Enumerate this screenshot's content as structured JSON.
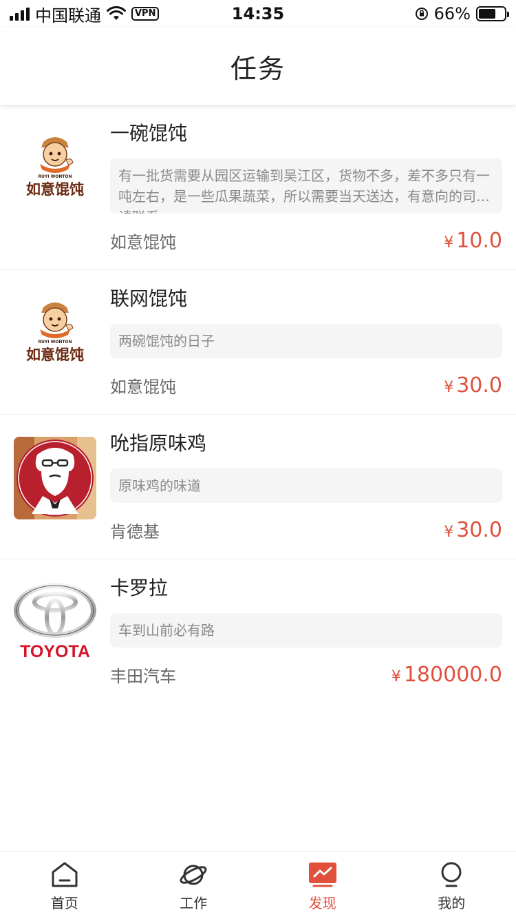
{
  "status_bar": {
    "carrier": "中国联通",
    "vpn": "VPN",
    "time": "14:35",
    "battery": "66%",
    "battery_fraction": 0.66
  },
  "header": {
    "title": "任务"
  },
  "tasks": [
    {
      "title": "一碗馄饨",
      "description": "有一批货需要从园区运输到吴江区，货物不多，差不多只有一吨左右，是一些瓜果蔬菜，所以需要当天送达，有意向的司机请联系。",
      "company": "如意馄饨",
      "currency": "¥",
      "price": "10.0",
      "logo": {
        "type": "ruyi",
        "text": "如意馄饨",
        "subtext": "RUYI WONTON"
      }
    },
    {
      "title": "联网馄饨",
      "description": "两碗馄饨的日子",
      "company": "如意馄饨",
      "currency": "¥",
      "price": "30.0",
      "logo": {
        "type": "ruyi",
        "text": "如意馄饨",
        "subtext": "RUYI WONTON"
      }
    },
    {
      "title": "吮指原味鸡",
      "description": "原味鸡的味道",
      "company": "肯德基",
      "currency": "¥",
      "price": "30.0",
      "logo": {
        "type": "kfc"
      }
    },
    {
      "title": "卡罗拉",
      "description": "车到山前必有路",
      "company": "丰田汽车",
      "currency": "¥",
      "price": "180000.0",
      "logo": {
        "type": "toyota",
        "text": "TOYOTA"
      }
    }
  ],
  "tabs": [
    {
      "label": "首页",
      "icon": "home-icon",
      "active": false
    },
    {
      "label": "工作",
      "icon": "planet-icon",
      "active": false
    },
    {
      "label": "发现",
      "icon": "trend-chart-icon",
      "active": true
    },
    {
      "label": "我的",
      "icon": "bulb-icon",
      "active": false
    }
  ],
  "colors": {
    "accent": "#e0503c",
    "text_primary": "#222222",
    "text_secondary": "#666666",
    "desc_bg": "#f5f5f5"
  }
}
